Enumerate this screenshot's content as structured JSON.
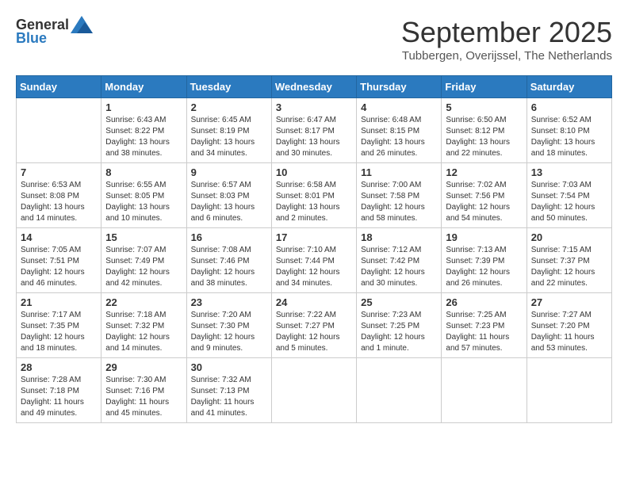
{
  "header": {
    "logo_general": "General",
    "logo_blue": "Blue",
    "month_title": "September 2025",
    "location": "Tubbergen, Overijssel, The Netherlands"
  },
  "weekdays": [
    "Sunday",
    "Monday",
    "Tuesday",
    "Wednesday",
    "Thursday",
    "Friday",
    "Saturday"
  ],
  "weeks": [
    [
      {
        "day": "",
        "content": ""
      },
      {
        "day": "1",
        "content": "Sunrise: 6:43 AM\nSunset: 8:22 PM\nDaylight: 13 hours\nand 38 minutes."
      },
      {
        "day": "2",
        "content": "Sunrise: 6:45 AM\nSunset: 8:19 PM\nDaylight: 13 hours\nand 34 minutes."
      },
      {
        "day": "3",
        "content": "Sunrise: 6:47 AM\nSunset: 8:17 PM\nDaylight: 13 hours\nand 30 minutes."
      },
      {
        "day": "4",
        "content": "Sunrise: 6:48 AM\nSunset: 8:15 PM\nDaylight: 13 hours\nand 26 minutes."
      },
      {
        "day": "5",
        "content": "Sunrise: 6:50 AM\nSunset: 8:12 PM\nDaylight: 13 hours\nand 22 minutes."
      },
      {
        "day": "6",
        "content": "Sunrise: 6:52 AM\nSunset: 8:10 PM\nDaylight: 13 hours\nand 18 minutes."
      }
    ],
    [
      {
        "day": "7",
        "content": "Sunrise: 6:53 AM\nSunset: 8:08 PM\nDaylight: 13 hours\nand 14 minutes."
      },
      {
        "day": "8",
        "content": "Sunrise: 6:55 AM\nSunset: 8:05 PM\nDaylight: 13 hours\nand 10 minutes."
      },
      {
        "day": "9",
        "content": "Sunrise: 6:57 AM\nSunset: 8:03 PM\nDaylight: 13 hours\nand 6 minutes."
      },
      {
        "day": "10",
        "content": "Sunrise: 6:58 AM\nSunset: 8:01 PM\nDaylight: 13 hours\nand 2 minutes."
      },
      {
        "day": "11",
        "content": "Sunrise: 7:00 AM\nSunset: 7:58 PM\nDaylight: 12 hours\nand 58 minutes."
      },
      {
        "day": "12",
        "content": "Sunrise: 7:02 AM\nSunset: 7:56 PM\nDaylight: 12 hours\nand 54 minutes."
      },
      {
        "day": "13",
        "content": "Sunrise: 7:03 AM\nSunset: 7:54 PM\nDaylight: 12 hours\nand 50 minutes."
      }
    ],
    [
      {
        "day": "14",
        "content": "Sunrise: 7:05 AM\nSunset: 7:51 PM\nDaylight: 12 hours\nand 46 minutes."
      },
      {
        "day": "15",
        "content": "Sunrise: 7:07 AM\nSunset: 7:49 PM\nDaylight: 12 hours\nand 42 minutes."
      },
      {
        "day": "16",
        "content": "Sunrise: 7:08 AM\nSunset: 7:46 PM\nDaylight: 12 hours\nand 38 minutes."
      },
      {
        "day": "17",
        "content": "Sunrise: 7:10 AM\nSunset: 7:44 PM\nDaylight: 12 hours\nand 34 minutes."
      },
      {
        "day": "18",
        "content": "Sunrise: 7:12 AM\nSunset: 7:42 PM\nDaylight: 12 hours\nand 30 minutes."
      },
      {
        "day": "19",
        "content": "Sunrise: 7:13 AM\nSunset: 7:39 PM\nDaylight: 12 hours\nand 26 minutes."
      },
      {
        "day": "20",
        "content": "Sunrise: 7:15 AM\nSunset: 7:37 PM\nDaylight: 12 hours\nand 22 minutes."
      }
    ],
    [
      {
        "day": "21",
        "content": "Sunrise: 7:17 AM\nSunset: 7:35 PM\nDaylight: 12 hours\nand 18 minutes."
      },
      {
        "day": "22",
        "content": "Sunrise: 7:18 AM\nSunset: 7:32 PM\nDaylight: 12 hours\nand 14 minutes."
      },
      {
        "day": "23",
        "content": "Sunrise: 7:20 AM\nSunset: 7:30 PM\nDaylight: 12 hours\nand 9 minutes."
      },
      {
        "day": "24",
        "content": "Sunrise: 7:22 AM\nSunset: 7:27 PM\nDaylight: 12 hours\nand 5 minutes."
      },
      {
        "day": "25",
        "content": "Sunrise: 7:23 AM\nSunset: 7:25 PM\nDaylight: 12 hours\nand 1 minute."
      },
      {
        "day": "26",
        "content": "Sunrise: 7:25 AM\nSunset: 7:23 PM\nDaylight: 11 hours\nand 57 minutes."
      },
      {
        "day": "27",
        "content": "Sunrise: 7:27 AM\nSunset: 7:20 PM\nDaylight: 11 hours\nand 53 minutes."
      }
    ],
    [
      {
        "day": "28",
        "content": "Sunrise: 7:28 AM\nSunset: 7:18 PM\nDaylight: 11 hours\nand 49 minutes."
      },
      {
        "day": "29",
        "content": "Sunrise: 7:30 AM\nSunset: 7:16 PM\nDaylight: 11 hours\nand 45 minutes."
      },
      {
        "day": "30",
        "content": "Sunrise: 7:32 AM\nSunset: 7:13 PM\nDaylight: 11 hours\nand 41 minutes."
      },
      {
        "day": "",
        "content": ""
      },
      {
        "day": "",
        "content": ""
      },
      {
        "day": "",
        "content": ""
      },
      {
        "day": "",
        "content": ""
      }
    ]
  ]
}
